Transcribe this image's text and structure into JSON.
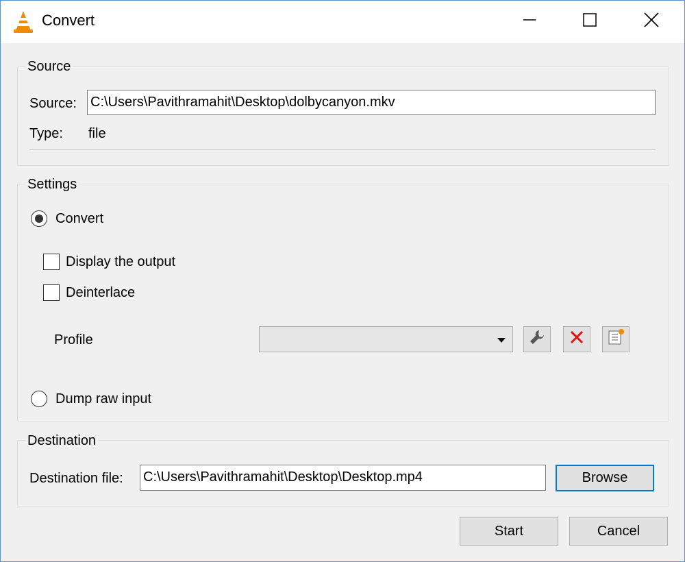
{
  "window": {
    "title": "Convert",
    "app_icon": "vlc-cone-icon",
    "controls": {
      "minimize": "minimize-icon",
      "maximize": "maximize-icon",
      "close": "close-icon"
    }
  },
  "source": {
    "group_title": "Source",
    "source_label": "Source:",
    "source_value": "C:\\Users\\Pavithramahit\\Desktop\\dolbycanyon.mkv",
    "type_label": "Type:",
    "type_value": "file"
  },
  "settings": {
    "group_title": "Settings",
    "convert_label": "Convert",
    "convert_selected": true,
    "display_output_label": "Display the output",
    "display_output_checked": false,
    "deinterlace_label": "Deinterlace",
    "deinterlace_checked": false,
    "profile_label": "Profile",
    "profile_value": "",
    "profile_buttons": {
      "edit": "wrench-icon",
      "delete": "red-x-icon",
      "new": "new-profile-icon"
    },
    "dump_raw_label": "Dump raw input",
    "dump_raw_selected": false
  },
  "destination": {
    "group_title": "Destination",
    "file_label": "Destination file:",
    "file_value": "C:\\Users\\Pavithramahit\\Desktop\\Desktop.mp4",
    "browse_label": "Browse"
  },
  "footer": {
    "start_label": "Start",
    "cancel_label": "Cancel"
  },
  "colors": {
    "accent": "#0078d7",
    "delete_red": "#e01010",
    "vlc_orange": "#f18a00"
  }
}
